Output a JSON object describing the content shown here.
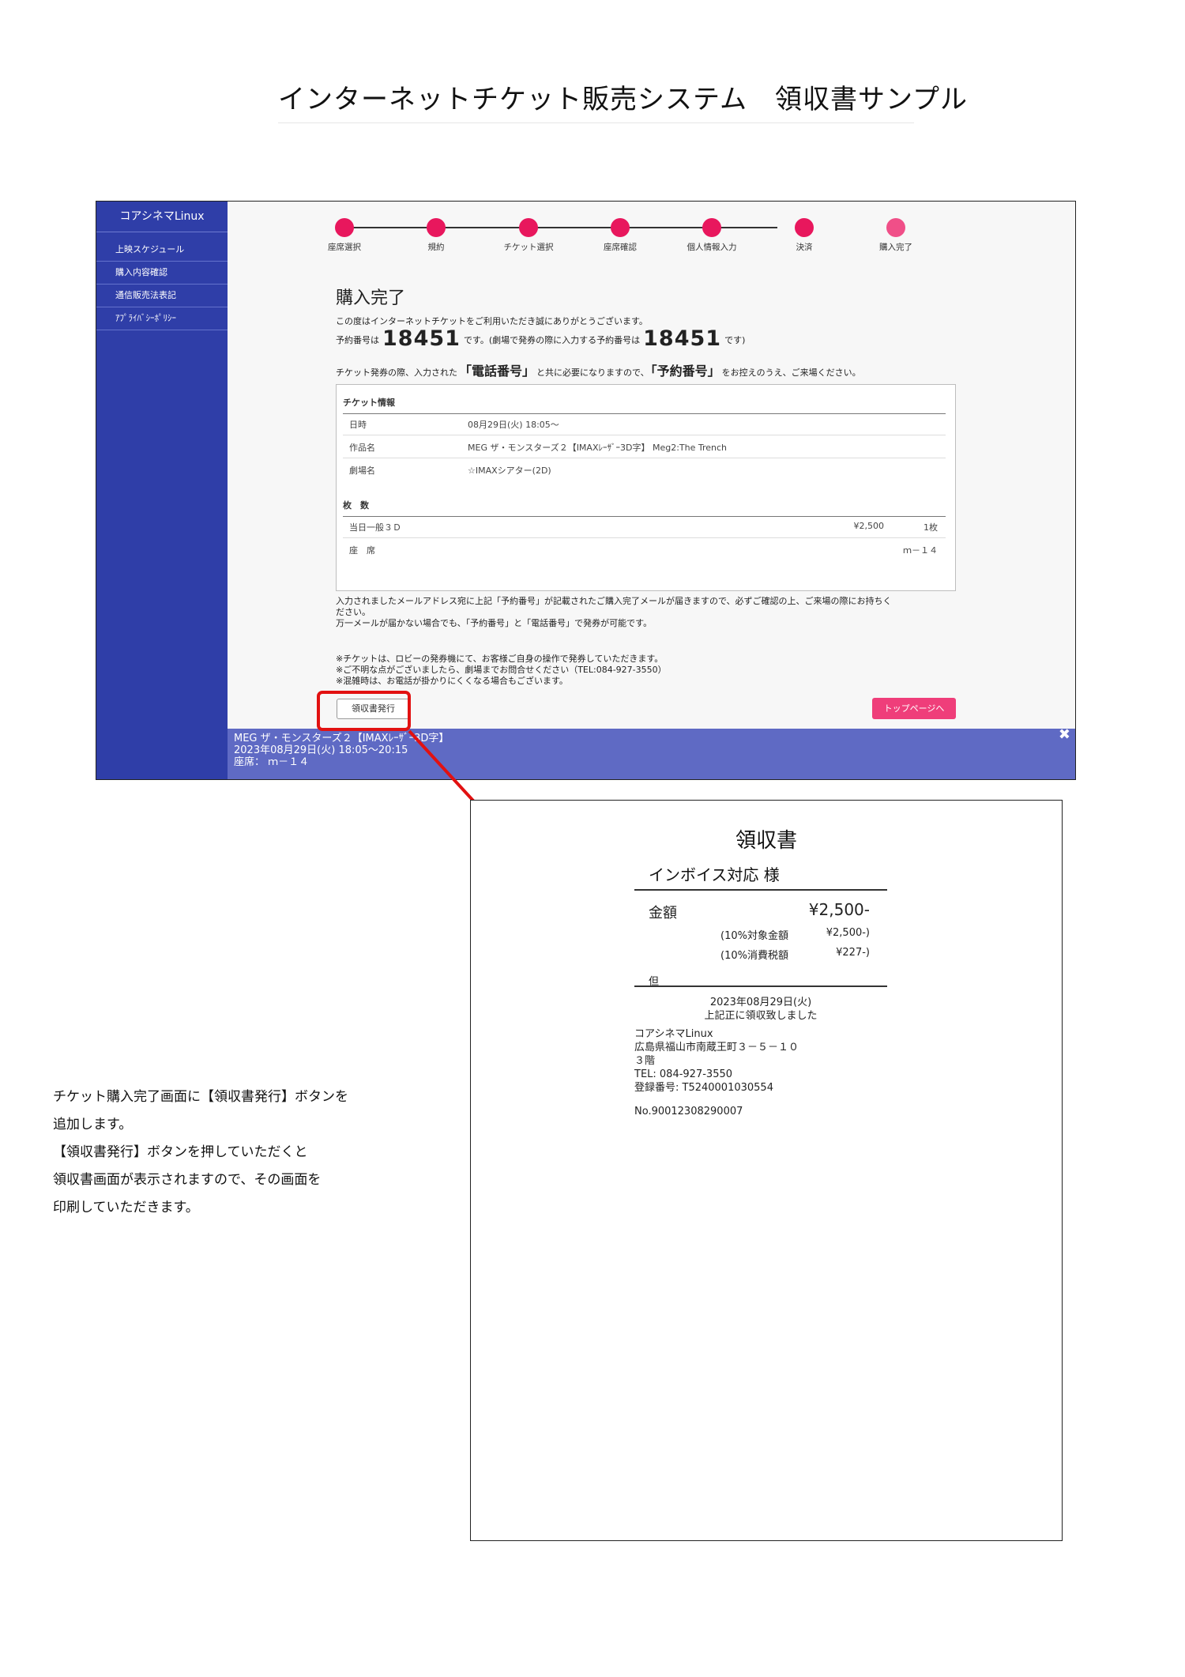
{
  "doc_title": "インターネットチケット販売システム　領収書サンプル",
  "sidebar": {
    "brand": "コアシネマLinux",
    "items": [
      "上映スケジュール",
      "購入内容確認",
      "通信販売法表記",
      "ｱﾌﾟﾗｲﾊﾞｼｰﾎﾟﾘｼｰ"
    ]
  },
  "steps": [
    "座席選択",
    "規約",
    "チケット選択",
    "座席確認",
    "個人情報入力",
    "決済",
    "購入完了"
  ],
  "complete": {
    "heading": "購入完了",
    "thanks": "この度はインターネットチケットをご利用いただき誠にありがとうございます。",
    "res_prefix": "予約番号は",
    "res_number": "18451",
    "res_mid": "です。(劇場で発券の際に入力する予約番号は",
    "res_number2": "18451",
    "res_suffix": "です)",
    "notice_a": "チケット発券の際、入力された",
    "notice_kw1": "「電話番号」",
    "notice_b": "と共に必要になりますので、",
    "notice_kw2": "「予約番号」",
    "notice_c": "をお控えのうえ、ご来場ください。"
  },
  "ticket_info": {
    "heading": "チケット情報",
    "rows": [
      {
        "label": "日時",
        "value": "08月29日(火) 18:05〜"
      },
      {
        "label": "作品名",
        "value": "MEG ザ・モンスターズ２【IMAXﾚｰｻﾞｰ3D字】 Meg2:The Trench"
      },
      {
        "label": "劇場名",
        "value": "☆IMAXシアター(2D)"
      }
    ],
    "count_heading": "枚　数",
    "ticket_type": "当日一般３Ｄ",
    "ticket_price": "¥2,500",
    "ticket_qty": "1枚",
    "seat_label": "座　席",
    "seat_value": "ｍ－１４"
  },
  "mail_notice": [
    "入力されましたメールアドレス宛に上記「予約番号」が記載されたご購入完了メールが届きますので、必ずご確認の上、ご来場の際にお持ちく",
    "ださい。",
    "万一メールが届かない場合でも、「予約番号」と「電話番号」で発券が可能です。"
  ],
  "caution": [
    "※チケットは、ロビーの発券機にて、お客様ご自身の操作で発券していただきます。",
    "※ご不明な点がございましたら、劇場までお問合せください（TEL:084-927-3550）",
    "※混雑時は、お電話が掛かりにくくなる場合もございます。"
  ],
  "buttons": {
    "receipt": "領収書発行",
    "top_page": "トップページへ"
  },
  "footer": {
    "line1": "MEG ザ・モンスターズ２【IMAXﾚｰｻﾞｰ3D字】",
    "line2": "2023年08月29日(火) 18:05〜20:15",
    "line3": "座席： ｍ－１４",
    "close": "✖"
  },
  "receipt": {
    "title": "領収書",
    "addressee": "インボイス対応 様",
    "amount_label": "金額",
    "amount": "¥2,500-",
    "taxable_label": "(10%対象金額",
    "taxable_value": "¥2,500-)",
    "tax_label": "(10%消費税額",
    "tax_value": "¥227-)",
    "proviso": "但",
    "date": "2023年08月29日(火)",
    "received": "上記正に領収致しました",
    "issuer_lines": [
      "コアシネマLinux",
      "広島県福山市南蔵王町３－５－１０",
      "３階",
      "TEL: 084-927-3550",
      "登録番号: T5240001030554"
    ],
    "number": "No.90012308290007"
  },
  "note_lines": [
    "チケット購入完了画面に【領収書発行】ボタンを",
    "追加します。",
    "【領収書発行】ボタンを押していただくと",
    "領収書画面が表示されますので、その画面を",
    "印刷していただきます。"
  ],
  "colors": {
    "sidebar": "#2f3ea8",
    "step_dot": "#e8175d",
    "top_button": "#ef3e7a",
    "footer": "#5f6ac4",
    "highlight": "#e21111"
  }
}
